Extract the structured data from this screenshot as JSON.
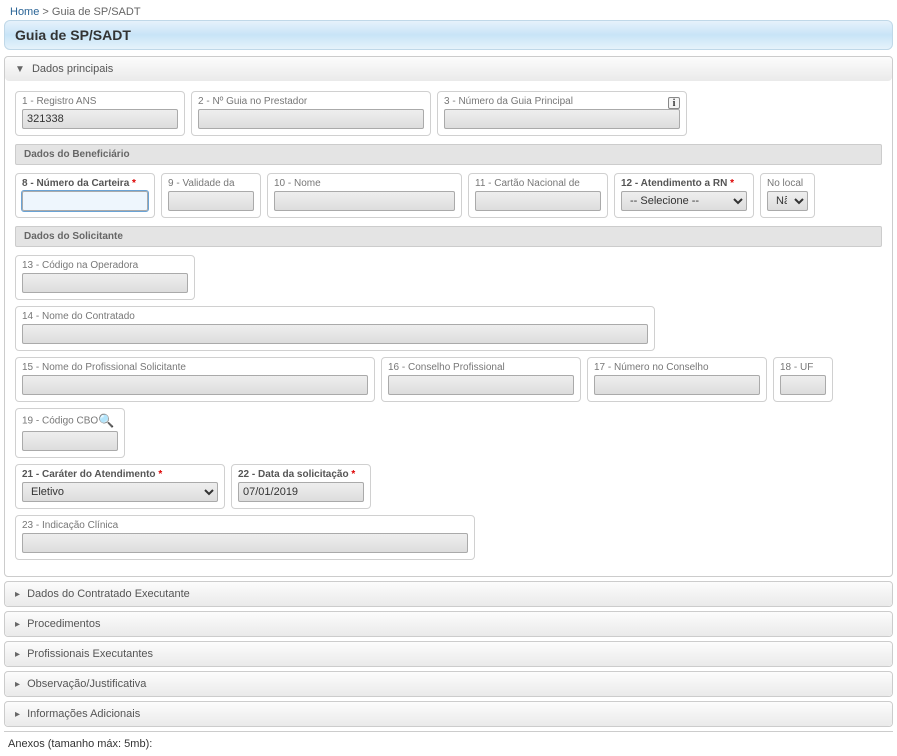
{
  "breadcrumb": {
    "home": "Home",
    "sep": ">",
    "current": "Guia de SP/SADT"
  },
  "page_title": "Guia de SP/SADT",
  "main_section": {
    "title": "Dados principais"
  },
  "fields": {
    "f1": {
      "label": "1 - Registro ANS",
      "value": "321338"
    },
    "f2": {
      "label": "2 - Nº Guia no Prestador",
      "value": ""
    },
    "f3": {
      "label": "3 - Número da Guia Principal",
      "value": ""
    }
  },
  "bar_beneficiario": "Dados do Beneficiário",
  "beneficiario": {
    "f8": {
      "label": "8 - Número da Carteira",
      "value": ""
    },
    "f9": {
      "label": "9 - Validade da",
      "value": ""
    },
    "f10": {
      "label": "10 - Nome",
      "value": ""
    },
    "f11": {
      "label": "11 - Cartão Nacional de",
      "value": ""
    },
    "f12": {
      "label": "12 - Atendimento a RN",
      "selected": "-- Selecione --"
    },
    "local": {
      "label": "No local",
      "selected": "Não"
    }
  },
  "bar_solicitante": "Dados do Solicitante",
  "solicitante": {
    "f13": {
      "label": "13 - Código na Operadora",
      "value": ""
    },
    "f14": {
      "label": "14 - Nome do Contratado",
      "value": ""
    },
    "f15": {
      "label": "15 - Nome do Profissional Solicitante",
      "value": ""
    },
    "f16": {
      "label": "16 - Conselho Profissional",
      "value": ""
    },
    "f17": {
      "label": "17 - Número no Conselho",
      "value": ""
    },
    "f18": {
      "label": "18 - UF",
      "value": ""
    },
    "f19": {
      "label": "19 - Código CBO",
      "value": ""
    },
    "f21": {
      "label": "21 - Caráter do Atendimento",
      "selected": "Eletivo"
    },
    "f22": {
      "label": "22 - Data da solicitação",
      "value": "07/01/2019"
    },
    "f23": {
      "label": "23 - Indicação Clínica",
      "value": ""
    }
  },
  "collapsed_sections": [
    "Dados do Contratado Executante",
    "Procedimentos",
    "Profissionais Executantes",
    "Observação/Justificativa",
    "Informações Adicionais"
  ],
  "anexos": "Anexos (tamanho máx: 5mb):"
}
